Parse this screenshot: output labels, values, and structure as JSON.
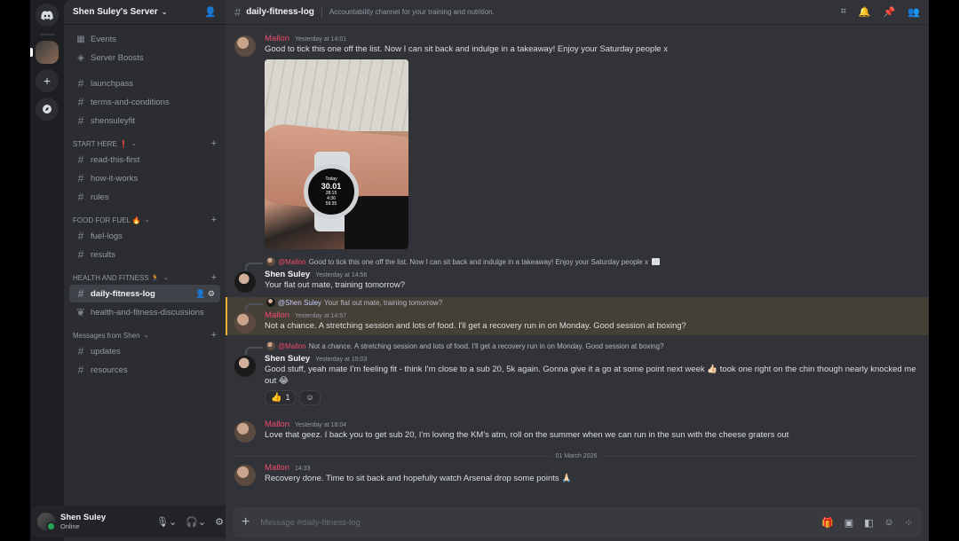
{
  "server": {
    "name": "Shen Suley's Server"
  },
  "sidebar": {
    "top_items": [
      {
        "label": "Events",
        "icon": "calendar-icon"
      },
      {
        "label": "Server Boosts",
        "icon": "boost-icon"
      }
    ],
    "channels_top": [
      "launchpass",
      "terms-and-conditions",
      "shensuleyfit"
    ],
    "categories": [
      {
        "name": "START HERE ❗",
        "channels": [
          "read-this-first",
          "how-it-works",
          "rules"
        ]
      },
      {
        "name": "FOOD FOR FUEL 🔥",
        "channels": [
          "fuel-logs",
          "results"
        ]
      },
      {
        "name": "HEALTH AND FITNESS 🏃",
        "channels": [
          "daily-fitness-log",
          "health-and-fitness-discussions"
        ]
      },
      {
        "name": "Messages from Shen",
        "channels": [
          "updates",
          "resources"
        ]
      }
    ]
  },
  "user": {
    "name": "Shen Suley",
    "status": "Online"
  },
  "channel": {
    "name": "daily-fitness-log",
    "topic": "Accountability channel for your training and nutrition."
  },
  "messages": [
    {
      "author": "Mallon",
      "time": "Yesterday at 14:01",
      "text": "Good to tick this one off the list. Now I can sit back and indulge in a takeaway! Enjoy your Saturday people x"
    },
    {
      "reply_mention": "@Mallon",
      "reply_text": "Good to tick this one off the list. Now I can sit back and indulge in a takeaway! Enjoy your Saturday people x",
      "author": "Shen Suley",
      "time": "Yesterday at 14:56",
      "text": "Your flat out mate, training tomorrow?"
    },
    {
      "reply_mention": "@Shen Suley",
      "reply_text": "Your flat out mate, training tomorrow?",
      "author": "Mallon",
      "time": "Yesterday at 14:57",
      "text": "Not a chance. A stretching session and lots of food. I'll get a recovery run in on Monday. Good session at boxing?"
    },
    {
      "reply_mention": "@Mallon",
      "reply_text": "Not a chance. A stretching session and lots of food. I'll get a recovery run in on Monday. Good session at boxing?",
      "author": "Shen Suley",
      "time": "Yesterday at 15:03",
      "text": "Good stuff, yeah mate I'm feeling fit - think I'm close to a sub 20, 5k again. Gonna give it a go at some point next week 👍🏻 took one right on the chin though nearly knocked me out 😂"
    },
    {
      "author": "Mallon",
      "time": "Yesterday at 18:04",
      "text": "Love that geez. I back you to get sub 20, I'm loving the KM's atm, roll on the summer when we can run in the sun with the cheese graters out"
    },
    {
      "author": "Mallon",
      "time": "14:33",
      "text": "Recovery done. Time to sit back and hopefully watch Arsenal drop some points 🙏🏻"
    }
  ],
  "watch": {
    "label": "Today",
    "distance": "30.01",
    "time": "28:15",
    "pace": "4:36",
    "calories": "59:35"
  },
  "reactions": [
    {
      "emoji": "👍",
      "count": "1"
    }
  ],
  "date_separator": "01 March 2026",
  "composer": {
    "placeholder": "Message #daily-fitness-log"
  },
  "colors": {
    "accent_mallon": "#f04a6d",
    "highlight": "#f0b232",
    "online": "#23a55a"
  }
}
